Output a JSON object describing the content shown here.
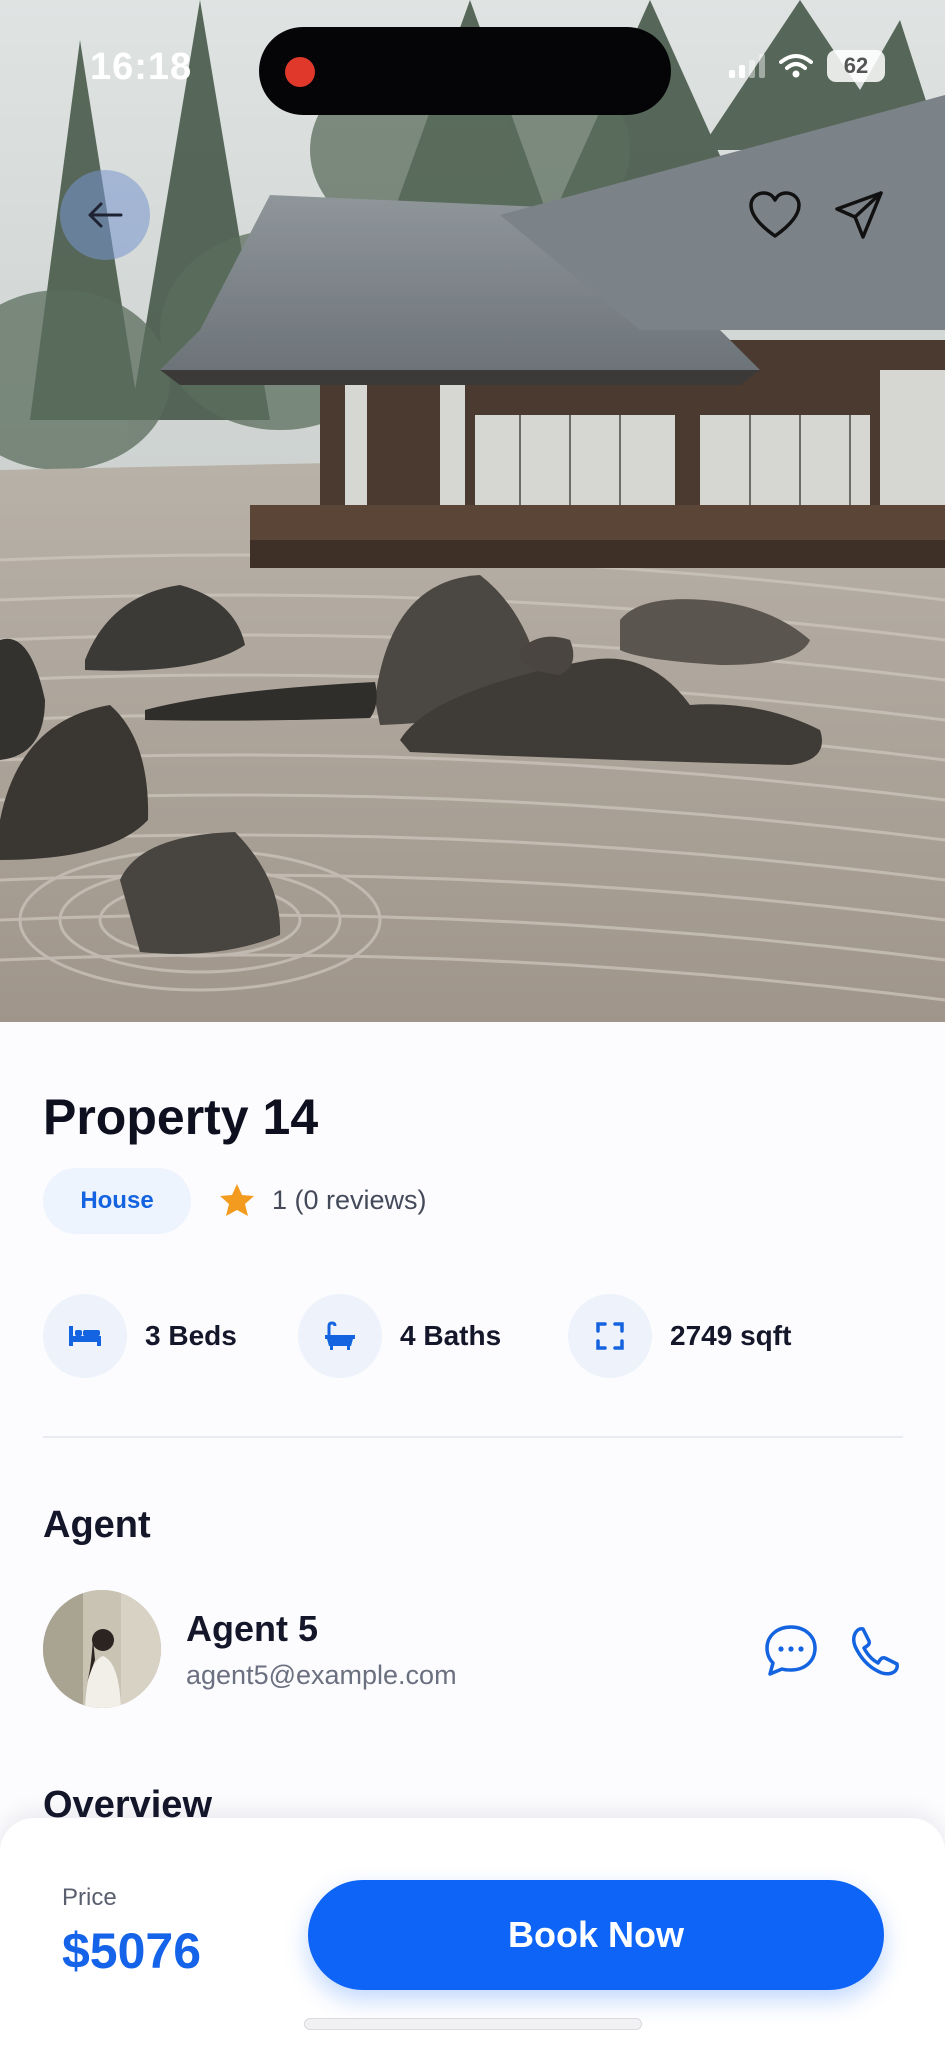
{
  "status_bar": {
    "time": "16:18",
    "battery": "62",
    "recording_color": "#e0392b"
  },
  "hero": {
    "image_subject": "zen rock garden with japanese temple",
    "back_icon": "arrow-left-icon",
    "favorite_icon": "heart-icon",
    "share_icon": "send-icon"
  },
  "property": {
    "title": "Property 14",
    "type": "House",
    "rating_text": "1 (0 reviews)",
    "features": [
      {
        "icon": "bed-icon",
        "label": "3 Beds"
      },
      {
        "icon": "bathtub-icon",
        "label": "4 Baths"
      },
      {
        "icon": "expand-icon",
        "label": "2749 sqft"
      }
    ]
  },
  "agent": {
    "section_title": "Agent",
    "name": "Agent 5",
    "email": "agent5@example.com"
  },
  "overview": {
    "section_title": "Overview"
  },
  "booking": {
    "price_label": "Price",
    "price": "$5076",
    "button_label": "Book Now"
  },
  "colors": {
    "accent": "#0d64f6",
    "star": "#f39b1f",
    "pill_bg": "#eef4fd"
  }
}
